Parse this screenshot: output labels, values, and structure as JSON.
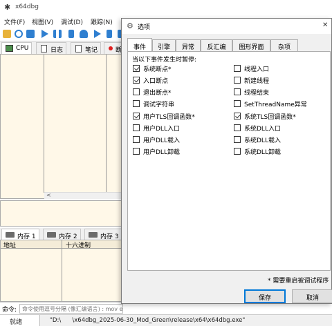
{
  "app": {
    "title": "x64dbg"
  },
  "menu": {
    "items": [
      "文件(F)",
      "视图(V)",
      "调试(D)",
      "跟踪(N)"
    ]
  },
  "main_tabs": [
    {
      "label": "CPU"
    },
    {
      "label": "日志"
    },
    {
      "label": "笔记"
    },
    {
      "label": "断"
    }
  ],
  "mem_tabs": [
    {
      "label": "内存 1"
    },
    {
      "label": "内存 2"
    },
    {
      "label": "内存 3"
    }
  ],
  "mem_grid": {
    "col_address": "地址",
    "col_hex": "十六进制"
  },
  "command": {
    "label": "命令:",
    "placeholder": "命令使用逗号分隔 (像汇编语言) : mov eax, ebx"
  },
  "status": {
    "state": "就绪",
    "path": "\"D:\\      \\x64dbg_2025-06-30_Mod_Green\\release\\x64\\x64dbg.exe\""
  },
  "dialog": {
    "title": "选项",
    "tabs": [
      {
        "label": "事件"
      },
      {
        "label": "引擎"
      },
      {
        "label": "异常"
      },
      {
        "label": "反汇编"
      },
      {
        "label": "图形界面"
      },
      {
        "label": "杂项"
      }
    ],
    "section_label": "当以下事件发生时暂停:",
    "left_options": [
      {
        "label": "系统断点*",
        "checked": true
      },
      {
        "label": "入口断点",
        "checked": true
      },
      {
        "label": "退出断点*",
        "checked": false
      },
      {
        "label": "调试字符串",
        "checked": false
      },
      {
        "label": "用户TLS回调函数*",
        "checked": true
      },
      {
        "label": "用户DLL入口",
        "checked": false
      },
      {
        "label": "用户DLL载入",
        "checked": false
      },
      {
        "label": "用户DLL卸载",
        "checked": false
      }
    ],
    "right_options": [
      {
        "label": "线程入口",
        "checked": false
      },
      {
        "label": "新建线程",
        "checked": false
      },
      {
        "label": "线程结束",
        "checked": false
      },
      {
        "label": "SetThreadName异常",
        "checked": false
      },
      {
        "label": "系统TLS回调函数*",
        "checked": true
      },
      {
        "label": "系统DLL入口",
        "checked": false
      },
      {
        "label": "系统DLL载入",
        "checked": false
      },
      {
        "label": "系统DLL卸载",
        "checked": false
      }
    ],
    "note": "* 需要重启被调试程序",
    "save_label": "保存",
    "cancel_label": "取消",
    "close_glyph": "✕"
  },
  "colors": {
    "accent": "#0078d7",
    "pane_bg": "#fff8e8"
  }
}
